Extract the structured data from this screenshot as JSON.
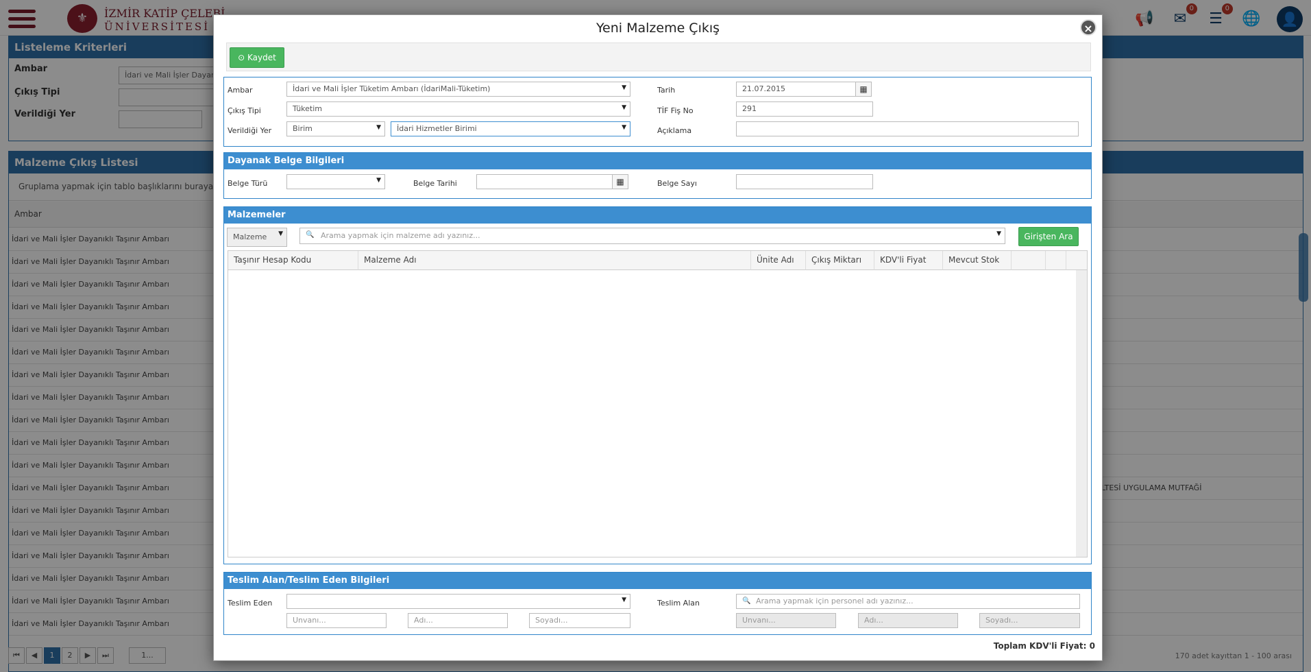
{
  "header": {
    "logo_line1": "İZMİR KATİP ÇELEBİ",
    "logo_line2": "ÜNİVERSİTESİ",
    "mail_count": "0",
    "tasks_count": "0",
    "icons": [
      "menu-icon",
      "megaphone-icon",
      "mail-icon",
      "list-icon",
      "globe-icon",
      "user-icon"
    ]
  },
  "criteria": {
    "title": "Listeleme Kriterleri",
    "ambar_label": "Ambar",
    "ambar_value": "İdari ve Mali İşler Dayan",
    "cikis_tipi_label": "Çıkış Tipi",
    "verildigi_yer_label": "Verildiği Yer"
  },
  "list": {
    "title": "Malzeme Çıkış Listesi",
    "group_hint": "Gruplama yapmak için tablo başlıklarını buraya sür",
    "col_ambar": "Ambar",
    "rows": [
      "İdari ve Mali İşler Dayanıklı Taşınır Ambarı",
      "İdari ve Mali İşler Dayanıklı Taşınır Ambarı",
      "İdari ve Mali İşler Dayanıklı Taşınır Ambarı",
      "İdari ve Mali İşler Dayanıklı Taşınır Ambarı",
      "İdari ve Mali İşler Dayanıklı Taşınır Ambarı",
      "İdari ve Mali İşler Dayanıklı Taşınır Ambarı",
      "İdari ve Mali İşler Dayanıklı Taşınır Ambarı",
      "İdari ve Mali İşler Dayanıklı Taşınır Ambarı",
      "İdari ve Mali İşler Dayanıklı Taşınır Ambarı",
      "İdari ve Mali İşler Dayanıklı Taşınır Ambarı",
      "İdari ve Mali İşler Dayanıklı Taşınır Ambarı",
      "İdari ve Mali İşler Dayanıklı Taşınır Ambarı",
      "İdari ve Mali İşler Dayanıklı Taşınır Ambarı",
      "İdari ve Mali İşler Dayanıklı Taşınır Ambarı",
      "İdari ve Mali İşler Dayanıklı Taşınır Ambarı",
      "İdari ve Mali İşler Dayanıklı Taşınır Ambarı",
      "İdari ve Mali İşler Dayanıklı Taşınır Ambarı",
      "İdari ve Mali İşler Dayanıklı Taşınır Ambarı"
    ],
    "row11_right": "LTESİ UYGULAMA MUTFAĞİ",
    "pages": [
      "1",
      "2"
    ],
    "page_size": "1...",
    "pager_info": "170 adet kayıttan 1 - 100 arası"
  },
  "modal": {
    "title": "Yeni Malzeme Çıkış",
    "save_label": "Kaydet",
    "ambar_label": "Ambar",
    "ambar_value": "İdari ve Mali İşler Tüketim Ambarı (İdariMali-Tüketim)",
    "cikis_tipi_label": "Çıkış Tipi",
    "cikis_tipi_value": "Tüketim",
    "verildigi_yer_label": "Verildiği Yer",
    "verildigi_yer_type": "Birim",
    "verildigi_yer_value": "İdari Hizmetler Birimi",
    "tarih_label": "Tarih",
    "tarih_value": "21.07.2015",
    "tif_label": "TİF Fiş No",
    "tif_value": "291",
    "aciklama_label": "Açıklama",
    "dayanak_title": "Dayanak Belge Bilgileri",
    "belge_turu_label": "Belge Türü",
    "belge_tarihi_label": "Belge Tarihi",
    "belge_sayi_label": "Belge Sayı",
    "malzemeler_title": "Malzemeler",
    "malzeme_type": "Malzeme",
    "malzeme_search_placeholder": "Arama yapmak için malzeme adı yazınız...",
    "girisden_ara": "Girişten Ara",
    "columns": [
      "Taşınır Hesap Kodu",
      "Malzeme Adı",
      "Ünite Adı",
      "Çıkış Miktarı",
      "KDV'li Fiyat",
      "Mevcut Stok"
    ],
    "teslim_title": "Teslim Alan/Teslim Eden Bilgileri",
    "teslim_eden_label": "Teslim Eden",
    "teslim_alan_label": "Teslim Alan",
    "teslim_alan_placeholder": "Arama yapmak için personel adı yazınız...",
    "unvan_placeholder": "Unvanı...",
    "adi_placeholder": "Adı...",
    "soyadi_placeholder": "Soyadı...",
    "total_label": "Toplam KDV'li Fiyat:",
    "total_value": "0"
  }
}
